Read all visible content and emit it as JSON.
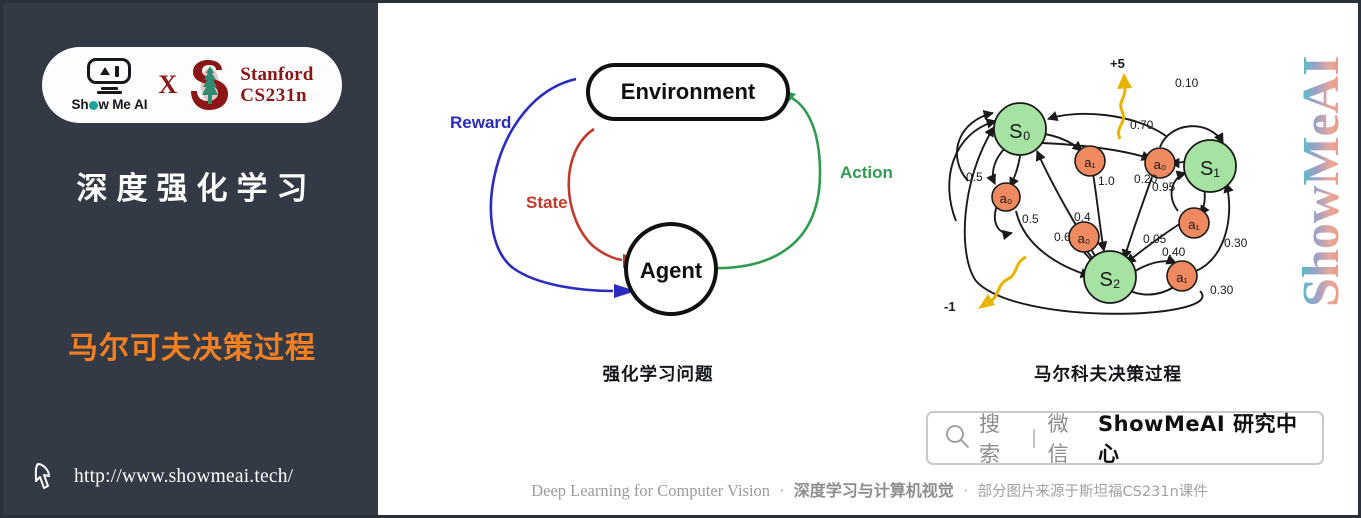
{
  "sidebar": {
    "logo": {
      "showmeai_word": "Show Me AI",
      "x_label": "X",
      "stanford_line1": "Stanford",
      "stanford_line2": "CS231n"
    },
    "title": "深度强化学习",
    "subtitle": "马尔可夫决策过程",
    "url": "http://www.showmeai.tech/",
    "bg_color": "#333a45",
    "title_color": "#ffffff",
    "subtitle_color": "#f28022",
    "stanford_color": "#8c1515"
  },
  "content": {
    "figure_rl": {
      "caption": "强化学习问题",
      "nodes": [
        {
          "id": "environment",
          "label": "Environment",
          "shape": "rounded-rect"
        },
        {
          "id": "agent",
          "label": "Agent",
          "shape": "circle"
        }
      ],
      "edges": [
        {
          "label": "Reward",
          "color": "#2b2bc0",
          "from": "environment",
          "to": "agent"
        },
        {
          "label": "State",
          "color": "#c03a2b",
          "from": "environment",
          "to": "agent"
        },
        {
          "label": "Action",
          "color": "#2e9b4f",
          "from": "agent",
          "to": "environment"
        }
      ]
    },
    "figure_mdp": {
      "caption": "马尔科夫决策过程",
      "state_color": "#a6e2a1",
      "action_color": "#ef8a60",
      "reward_color": "#e8b400",
      "states": [
        "S₀",
        "S₁",
        "S₂"
      ],
      "actions": [
        "a₀",
        "a₁",
        "a₀",
        "a₁",
        "a₀",
        "a₁"
      ],
      "rewards": [
        "+5",
        "-1"
      ],
      "probabilities": [
        "0.10",
        "0.70",
        "0.20",
        "0.95",
        "0.05",
        "0.40",
        "0.30",
        "0.30",
        "1.0",
        "0.5",
        "0.5",
        "0.4",
        "0.6"
      ]
    },
    "watermark": "ShowMeAI",
    "search": {
      "icon": "search-icon",
      "placeholder_text": "搜索",
      "separator": "|",
      "channel": "微信",
      "account": "ShowMeAI 研究中心"
    },
    "footer": {
      "en": "Deep Learning for Computer Vision",
      "dot1": "·",
      "cn_bold": "深度学习与计算机视觉",
      "dot2": "·",
      "cn_plain": "部分图片来源于斯坦福CS231n课件"
    }
  }
}
